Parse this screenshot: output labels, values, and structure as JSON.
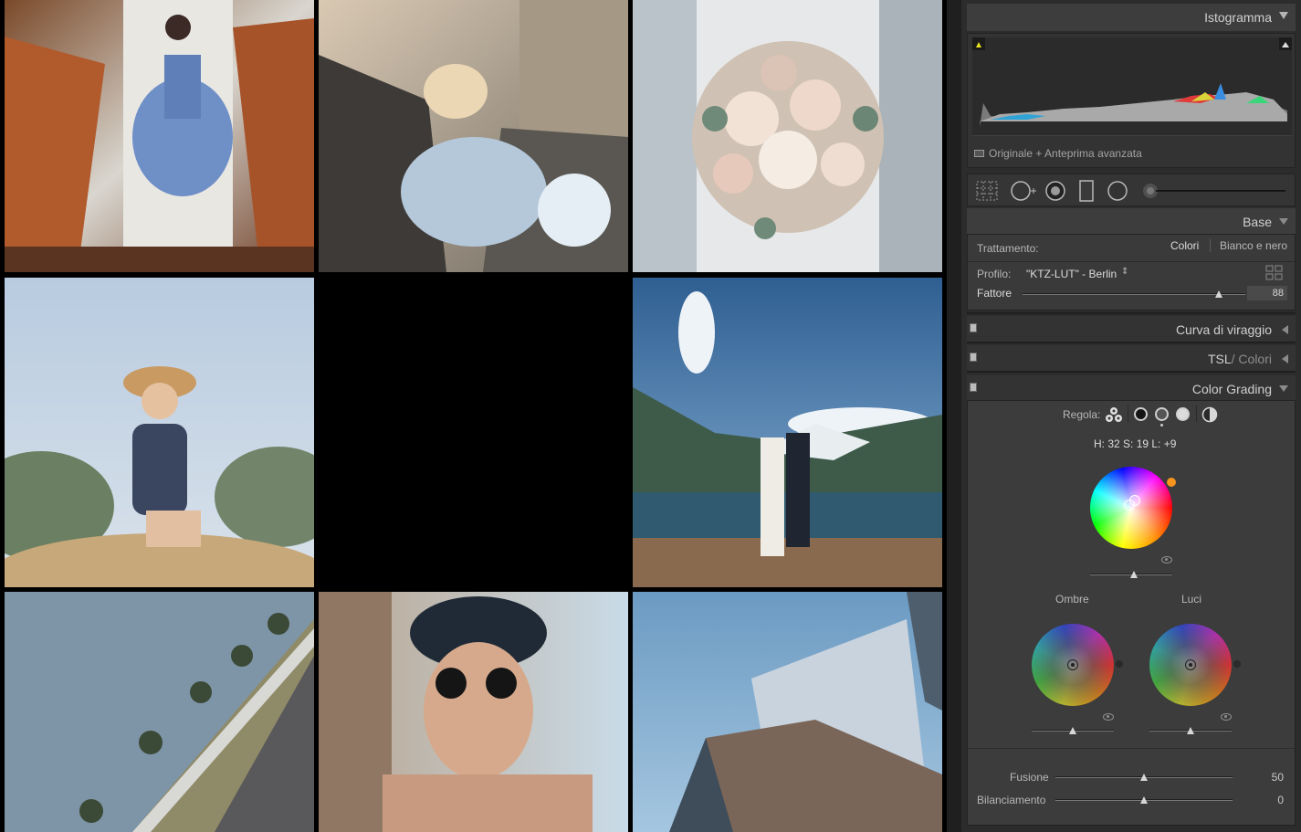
{
  "histogram": {
    "title": "Istogramma",
    "preview_label": "Originale + Anteprima avanzata"
  },
  "base": {
    "title": "Base",
    "treatment_label": "Trattamento:",
    "treatment_color": "Colori",
    "treatment_bw": "Bianco e nero",
    "profile_label": "Profilo:",
    "profile_value": "\"KTZ-LUT\" - Berlin",
    "profile_arrow": "⇕",
    "amount_label": "Fattore",
    "amount_value": "88",
    "amount_fraction": 0.88
  },
  "tone_curve": {
    "title": "Curva di viraggio"
  },
  "hsl": {
    "title": "TSL",
    "title_alt": "/ Colori"
  },
  "color_grading": {
    "title": "Color Grading",
    "adjust_label": "Regola:",
    "hsl_readout": "H: 32 S: 19 L: +9",
    "shadows_label": "Ombre",
    "highlights_label": "Luci",
    "blending_label": "Fusione",
    "blending_value": "50",
    "blending_fraction": 0.5,
    "balance_label": "Bilanciamento",
    "balance_value": "0",
    "balance_fraction": 0.5,
    "accent_color": "#f7941d"
  }
}
